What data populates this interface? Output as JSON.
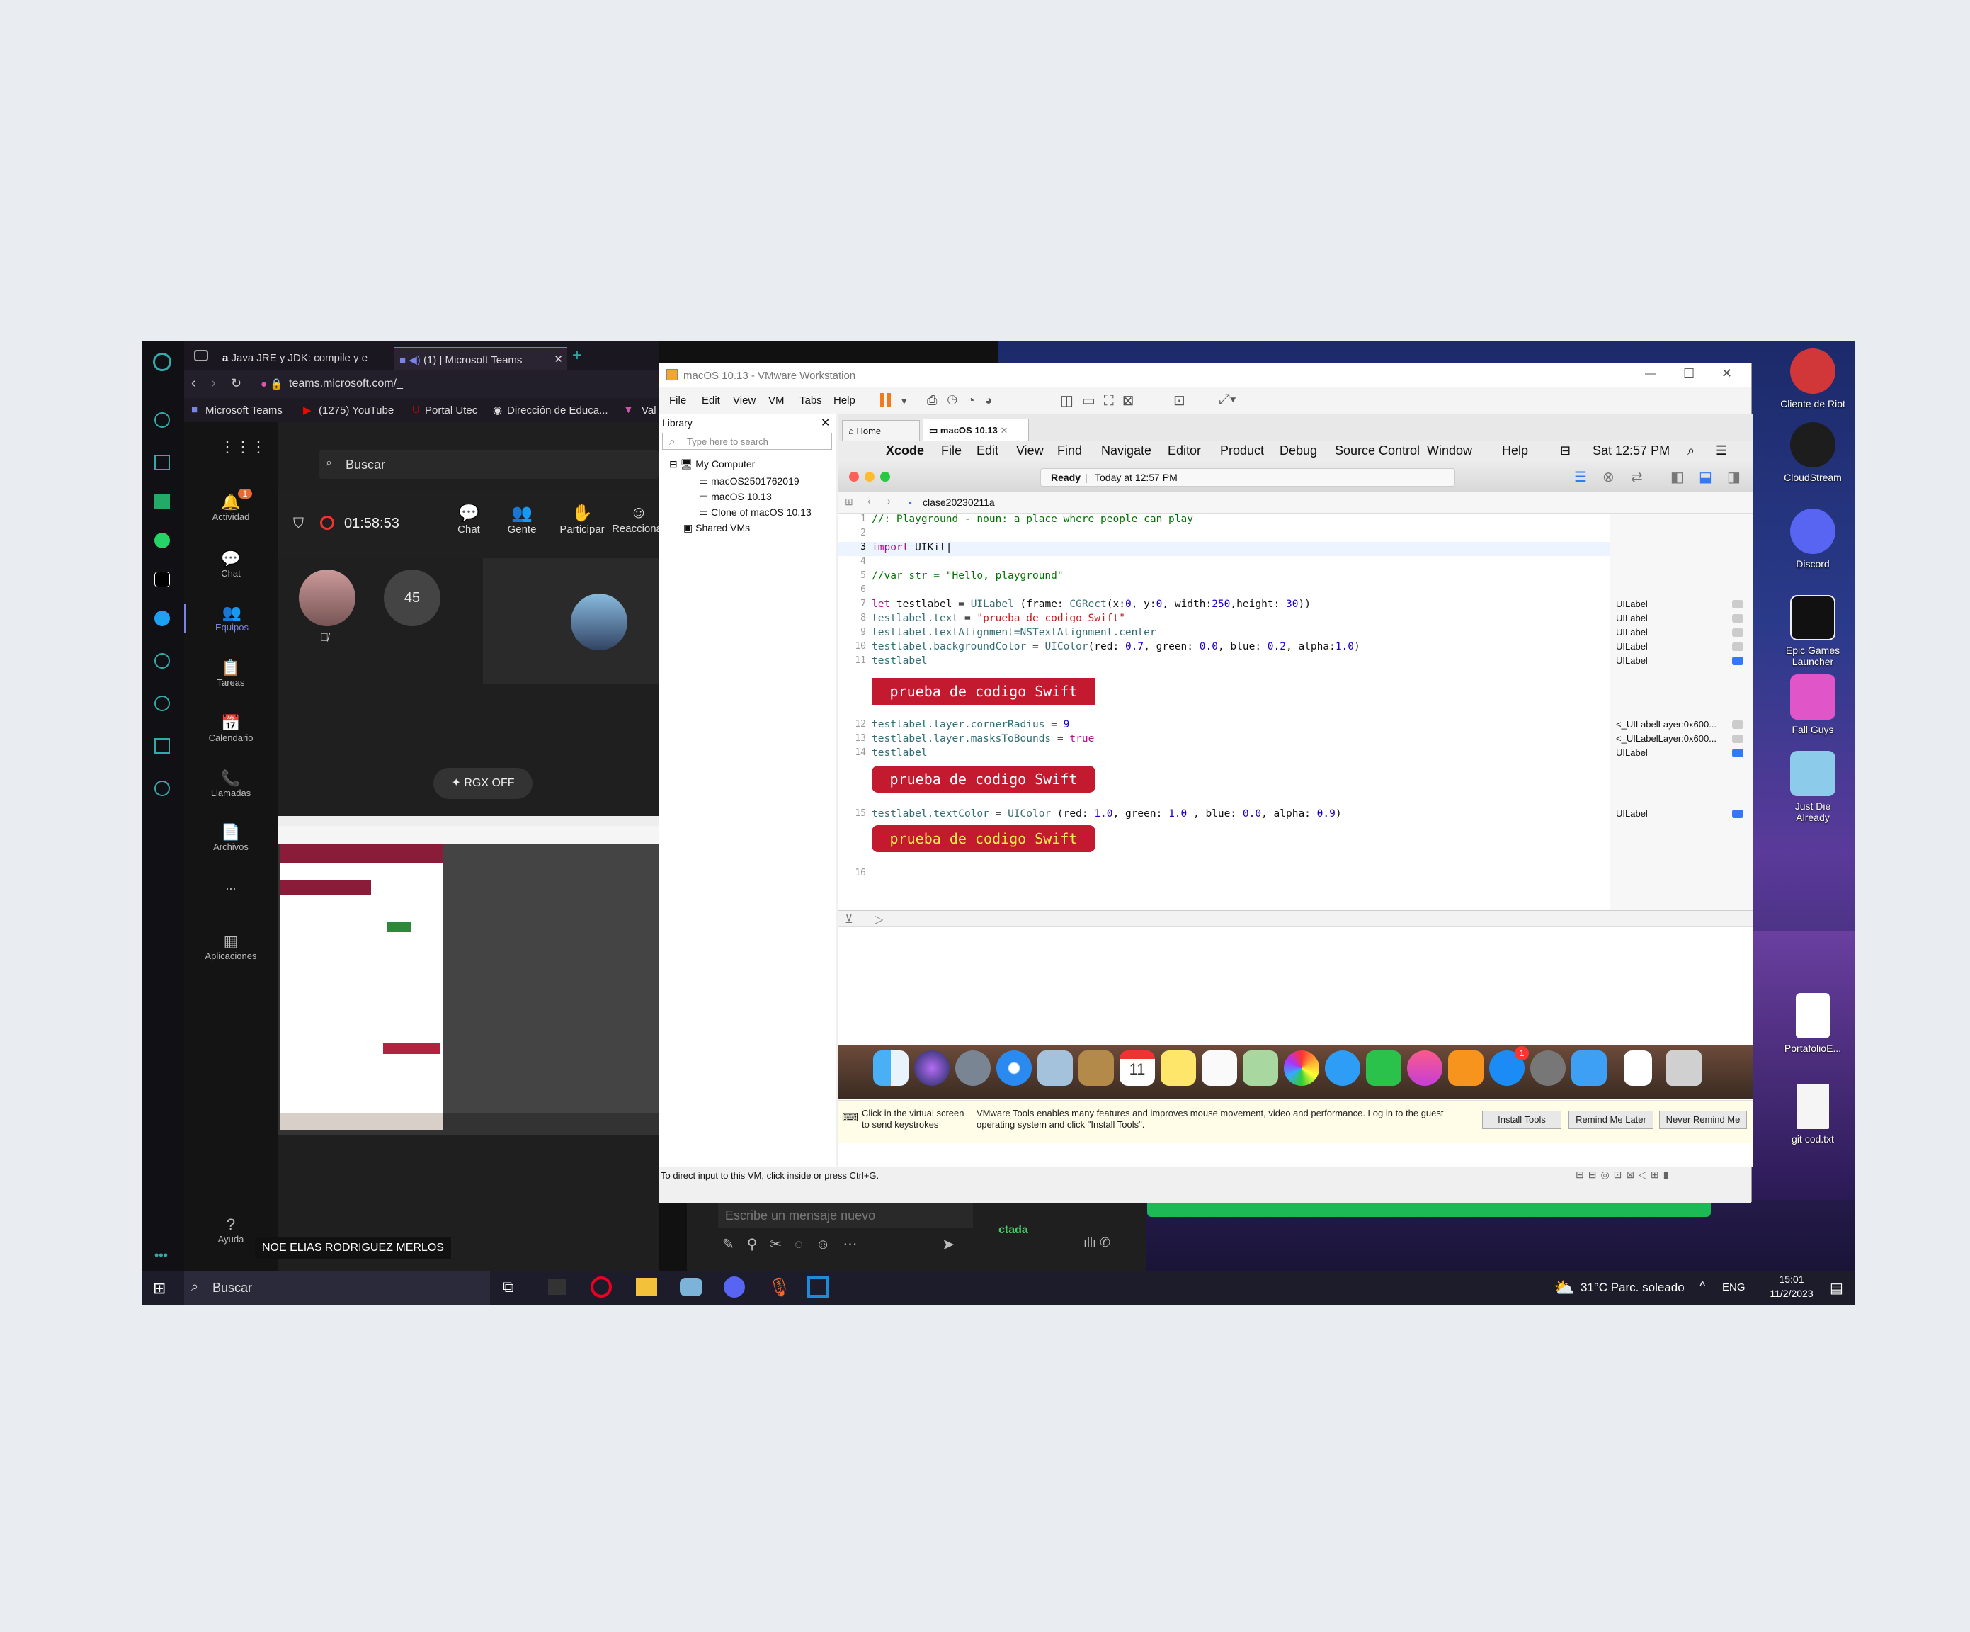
{
  "browser": {
    "tabs": [
      {
        "label": "Java JRE y JDK: compile y e"
      },
      {
        "label": "(1) | Microsoft Teams"
      }
    ],
    "url": "teams.microsoft.com/_",
    "bookmarks": [
      "Microsoft Teams",
      "(1275) YouTube",
      "Portal Utec",
      "Dirección de Educa...",
      "Val"
    ]
  },
  "teams": {
    "search_placeholder": "Buscar",
    "nav": [
      {
        "label": "Actividad",
        "badge": "1"
      },
      {
        "label": "Chat"
      },
      {
        "label": "Equipos"
      },
      {
        "label": "Tareas"
      },
      {
        "label": "Calendario"
      },
      {
        "label": "Llamadas"
      },
      {
        "label": "Archivos"
      },
      {
        "label": "..."
      },
      {
        "label": "Aplicaciones"
      }
    ],
    "help_label": "Ayuda",
    "meeting_timer": "01:58:53",
    "meeting_actions": [
      "Chat",
      "Gente",
      "Participar",
      "Reaccionar"
    ],
    "participant_count": "45",
    "rgx_label": "RGX OFF",
    "presenter_name": "NOE ELIAS RODRIGUEZ MERLOS",
    "message_placeholder": "Escribe un mensaje nuevo",
    "connected_partial": "ctada"
  },
  "vmware": {
    "title": "macOS 10.13 - VMware Workstation",
    "menu": [
      "File",
      "Edit",
      "View",
      "VM",
      "Tabs",
      "Help"
    ],
    "library_title": "Library",
    "library_search_placeholder": "Type here to search",
    "library_tree": {
      "root": "My Computer",
      "children": [
        "macOS2501762019",
        "macOS 10.13",
        "Clone of macOS 10.13"
      ],
      "shared": "Shared VMs"
    },
    "vm_tabs": [
      "Home",
      "macOS 10.13"
    ],
    "status_text": "To direct input to this VM, click inside or press Ctrl+G.",
    "tools_hint_left": "Click in the virtual screen to send keystrokes",
    "tools_message": "VMware Tools enables many features and improves mouse movement, video and performance. Log in to the guest operating system and click \"Install Tools\".",
    "install_tools": "Install Tools",
    "remind_later": "Remind Me Later",
    "never_remind": "Never Remind Me"
  },
  "mac": {
    "menubar": [
      "Xcode",
      "File",
      "Edit",
      "View",
      "Find",
      "Navigate",
      "Editor",
      "Product",
      "Debug",
      "Source Control",
      "Window",
      "Help"
    ],
    "clock": "Sat 12:57 PM",
    "activity_status": "Ready",
    "activity_time": "Today at 12:57 PM",
    "jump_file": "clase20230211a",
    "dock_badge": "1",
    "calendar_day": "11"
  },
  "code": {
    "lines": [
      {
        "n": "1",
        "text": "//: Playground - noun: a place where people can play"
      },
      {
        "n": "2",
        "text": ""
      },
      {
        "n": "3",
        "text": "import UIKit"
      },
      {
        "n": "4",
        "text": ""
      },
      {
        "n": "5",
        "text": "//var str = \"Hello, playground\""
      },
      {
        "n": "6",
        "text": ""
      },
      {
        "n": "7",
        "text": "let testlabel = UILabel (frame: CGRect(x:0, y:0, width:250,height: 30))"
      },
      {
        "n": "8",
        "text": "testlabel.text = \"prueba de codigo Swift\""
      },
      {
        "n": "9",
        "text": "testlabel.textAlignment=NSTextAlignment.center"
      },
      {
        "n": "10",
        "text": "testlabel.backgroundColor = UIColor(red: 0.7, green: 0.0, blue: 0.2, alpha:1.0)"
      },
      {
        "n": "11",
        "text": "testlabel"
      },
      {
        "n": "12",
        "text": "testlabel.layer.cornerRadius = 9"
      },
      {
        "n": "13",
        "text": "testlabel.layer.masksToBounds = true"
      },
      {
        "n": "14",
        "text": "testlabel"
      },
      {
        "n": "15",
        "text": "testlabel.textColor = UIColor (red: 1.0, green: 1.0 , blue: 0.0, alpha: 0.9)"
      },
      {
        "n": "16",
        "text": ""
      }
    ],
    "preview_text": "prueba de codigo Swift",
    "results": [
      "UILabel",
      "UILabel",
      "UILabel",
      "UILabel",
      "UILabel",
      "<_UILabelLayer:0x600...",
      "<_UILabelLayer:0x600...",
      "UILabel",
      "UILabel"
    ]
  },
  "desktop": {
    "icons": [
      {
        "label": "Cliente de Riot"
      },
      {
        "label": "CloudStream"
      },
      {
        "label": "Discord"
      },
      {
        "label": "Epic Games Launcher"
      },
      {
        "label": "Fall Guys"
      },
      {
        "label": "Just Die Already"
      },
      {
        "label": "PortafolioE..."
      },
      {
        "label": "git cod.txt"
      }
    ]
  },
  "taskbar": {
    "search": "Buscar",
    "weather": "31°C  Parc. soleado",
    "lang": "ENG",
    "time": "15:01",
    "date": "11/2/2023"
  },
  "colors": {
    "swift_label_bg": "#c41a30",
    "swift_label_text_final": "#ffff00",
    "teams_accent": "#7b83eb"
  }
}
